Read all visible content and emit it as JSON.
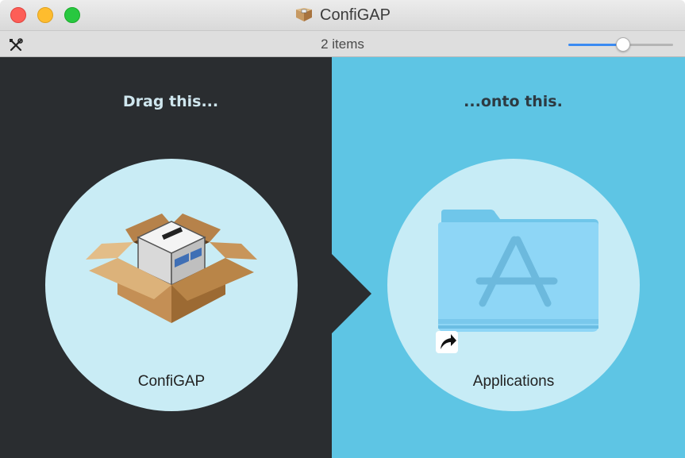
{
  "window": {
    "title": "ConfiGAP",
    "title_icon": "package-box-icon"
  },
  "toolbar": {
    "tools_icon": "tools-icon",
    "item_count": "2 items",
    "icon_size_fraction": 0.53
  },
  "left_pane": {
    "heading": "Drag this...",
    "item_label": "ConfiGAP",
    "item_icon": "package-box-icon"
  },
  "right_pane": {
    "heading": "...onto this.",
    "item_label": "Applications",
    "item_icon": "applications-folder-icon",
    "alias_icon": "alias-arrow-icon"
  },
  "colors": {
    "left_background": "#2a2d30",
    "right_background": "#5ec5e4",
    "circle_fill": "#c9ecf5",
    "slider_accent": "#3b8bf2"
  }
}
